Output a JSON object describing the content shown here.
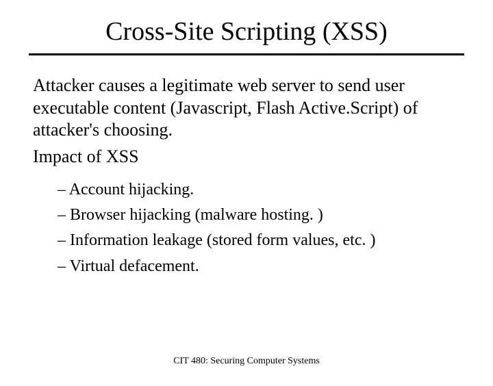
{
  "title": "Cross-Site Scripting (XSS)",
  "intro": "Attacker causes a legitimate web server to send user executable content (Javascript, Flash Active.Script) of attacker's choosing.",
  "impact_heading": "Impact of XSS",
  "impacts": [
    "Account hijacking.",
    "Browser hijacking (malware hosting. )",
    "Information leakage (stored form values, etc. )",
    "Virtual defacement."
  ],
  "footer": "CIT 480: Securing Computer Systems"
}
